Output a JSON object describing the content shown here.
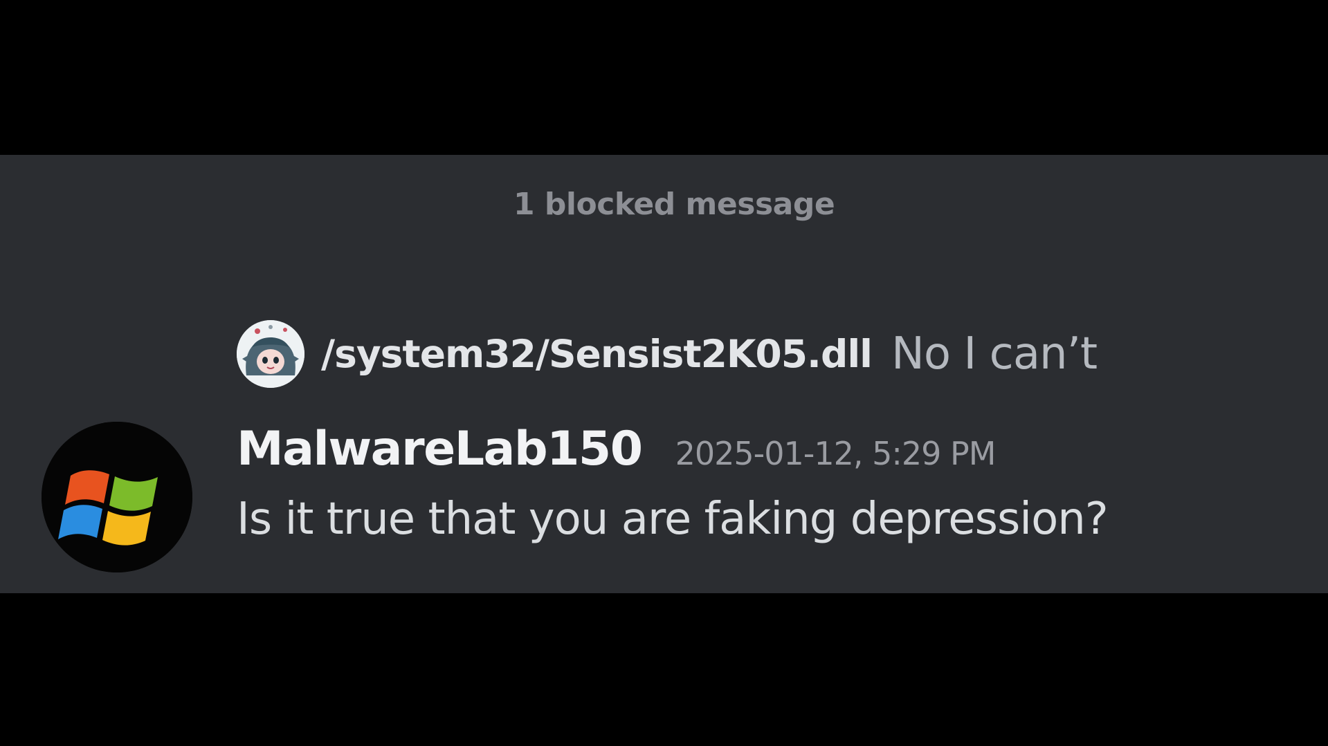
{
  "blocked_notice": "1 blocked message",
  "reply": {
    "avatar_icon": "anime-character-avatar",
    "username": "/system32/Sensist2K05.dll",
    "text": "No I can’t"
  },
  "message": {
    "avatar_icon": "windows-logo-icon",
    "author": "MalwareLab150",
    "timestamp": "2025-01-12, 5:29 PM",
    "content": "Is it true that you are faking depression?"
  },
  "colors": {
    "background_outer": "#000000",
    "panel": "#2b2d31",
    "username": "#f2f3f5",
    "muted": "#9a9ca2",
    "message_text": "#dbdee1",
    "windows_red": "#e8531f",
    "windows_green": "#7cbb2a",
    "windows_blue": "#2a8de0",
    "windows_yellow": "#f5b81b"
  }
}
